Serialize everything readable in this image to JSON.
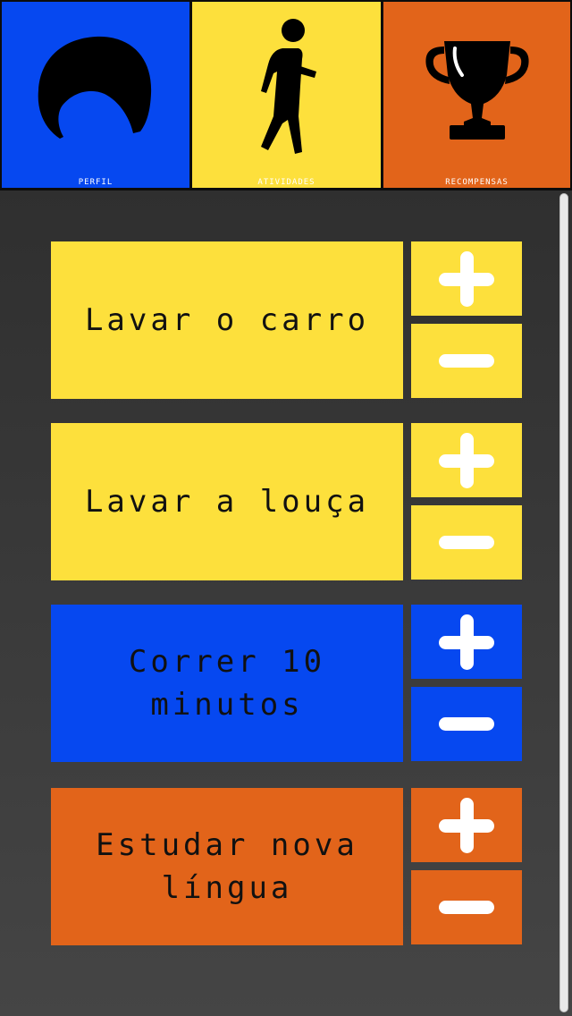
{
  "nav": {
    "tabs": [
      {
        "label": "PERFIL",
        "icon": "profile-hair-icon",
        "color": "#0648f0"
      },
      {
        "label": "ATIVIDADES",
        "icon": "walking-person-icon",
        "color": "#fde03c"
      },
      {
        "label": "RECOMPENSAS",
        "icon": "trophy-icon",
        "color": "#e2641a"
      }
    ]
  },
  "activities": [
    {
      "name": "Lavar o carro",
      "color": "#fde03c"
    },
    {
      "name": "Lavar a louça",
      "color": "#fde03c"
    },
    {
      "name": "Correr 10\nminutos",
      "color": "#0648f0"
    },
    {
      "name": "Estudar nova\nlíngua",
      "color": "#e2641a"
    }
  ],
  "colors": {
    "blue": "#0648f0",
    "yellow": "#fde03c",
    "orange": "#e2641a"
  }
}
